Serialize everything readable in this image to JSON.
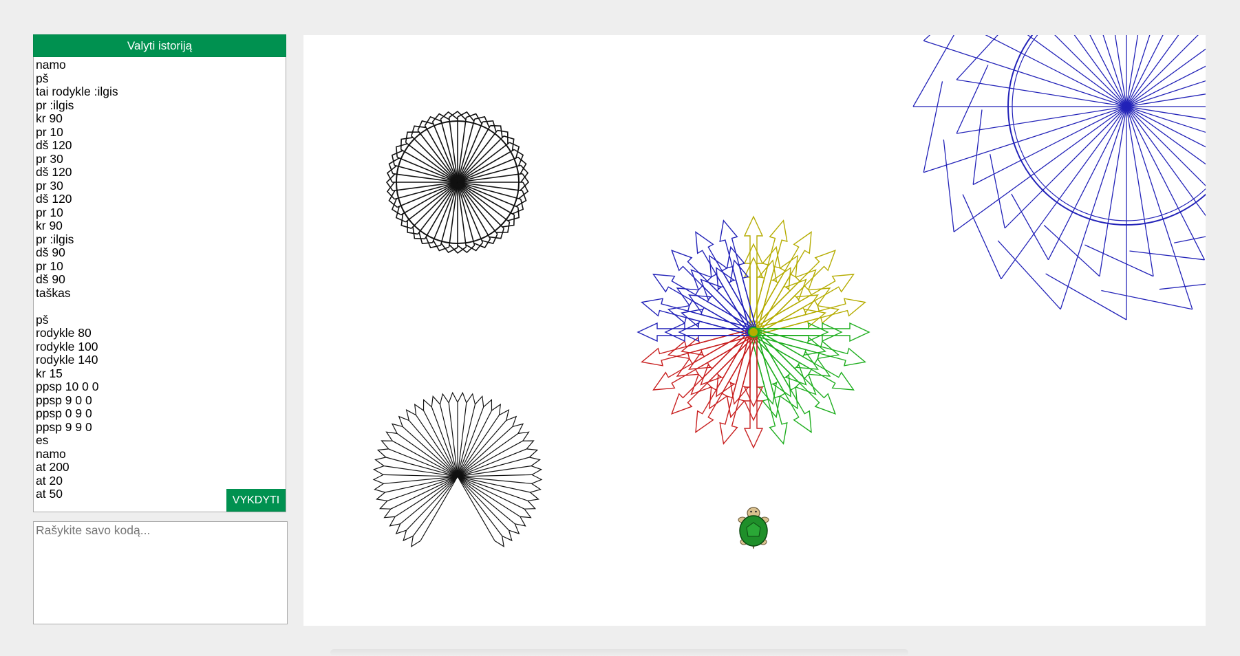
{
  "sidebar": {
    "clear_history_label": "Valyti istoriją",
    "run_label": "VYKDYTI",
    "history": [
      "namo",
      "pš",
      "tai rodykle :ilgis",
      "pr :ilgis",
      "kr 90",
      "pr 10",
      "dš 120",
      "pr 30",
      "dš 120",
      "pr 30",
      "dš 120",
      "pr 10",
      "kr 90",
      "pr :ilgis",
      "dš 90",
      "pr 10",
      "dš 90",
      "taškas",
      "",
      "pš",
      "rodykle 80",
      "rodykle 100",
      "rodykle 140",
      "kr 15",
      "ppsp 10 0 0",
      "ppsp 9 0 0",
      "ppsp 0 9 0",
      "ppsp 9 9 0",
      "es",
      "namo",
      "at 200",
      "at 20",
      "at 50"
    ]
  },
  "editor": {
    "placeholder": "Rašykite savo kodą...",
    "value": ""
  },
  "canvas": {
    "colors": {
      "black": "#111111",
      "blue": "#2222b8",
      "yellow": "#b5ac00",
      "green": "#1fae1f",
      "red": "#c81f1f",
      "turtle_shell": "#1f8f2a",
      "turtle_skin": "#d9c08e"
    },
    "icons": [
      "turtle-icon"
    ]
  },
  "colors": {
    "accent": "#009150",
    "background": "#eeeeee",
    "canvas": "#ffffff"
  }
}
